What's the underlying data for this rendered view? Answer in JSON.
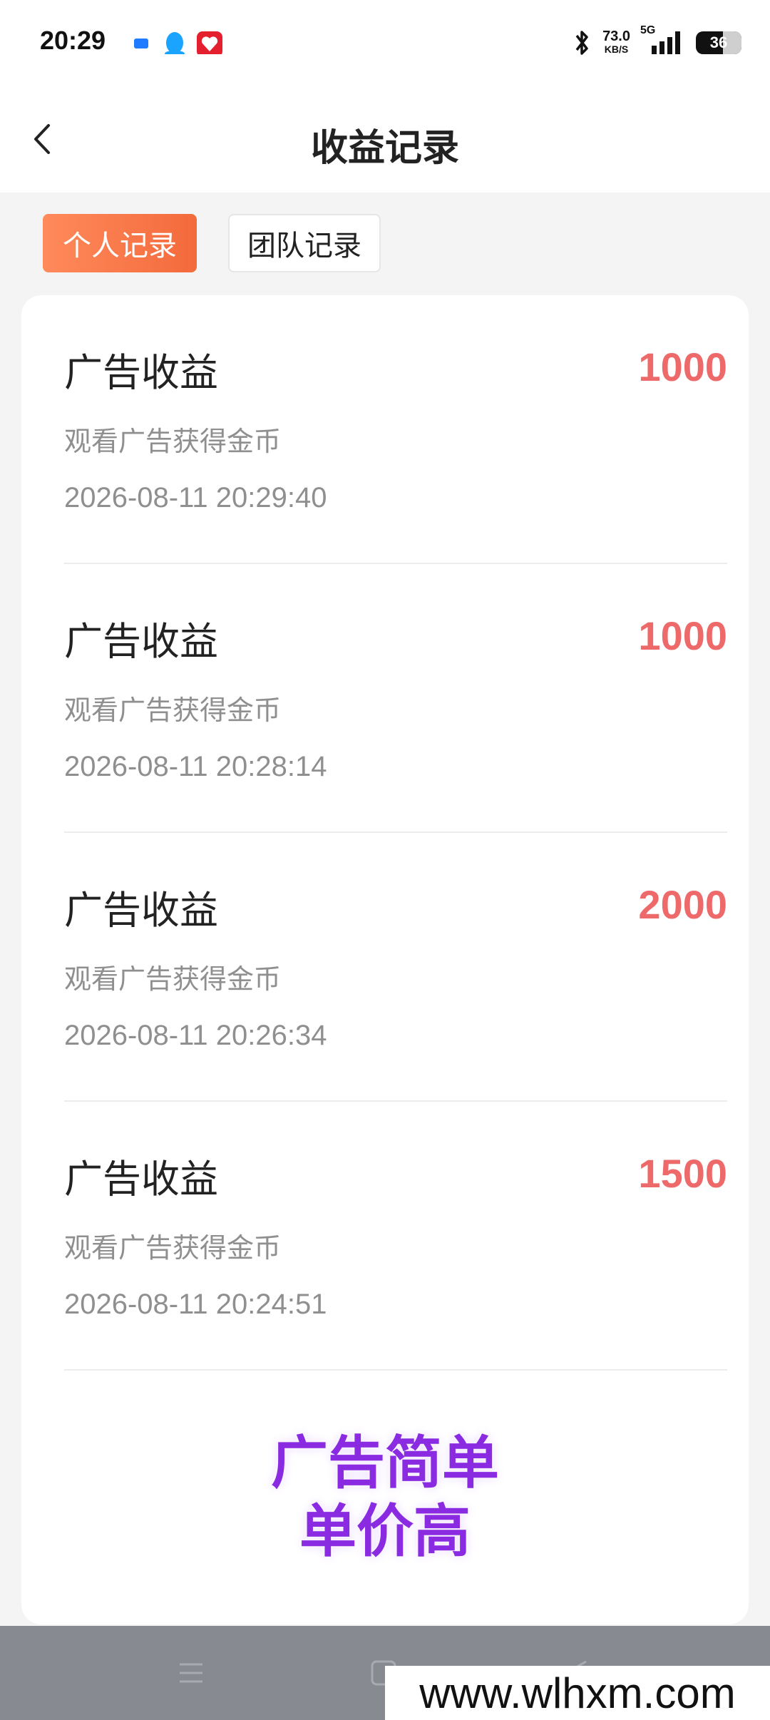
{
  "status_bar": {
    "time": "20:29",
    "icons_left": [
      "message-app-icon",
      "qq-icon",
      "app-red-icon"
    ],
    "net_speed_value": "73.0",
    "net_speed_unit": "KB/S",
    "network": "5G",
    "battery": "36"
  },
  "header": {
    "title": "收益记录"
  },
  "tabs": [
    {
      "label": "个人记录",
      "active": true
    },
    {
      "label": "团队记录",
      "active": false
    }
  ],
  "records": [
    {
      "title": "广告收益",
      "amount": "1000",
      "desc": "观看广告获得金币",
      "time": "2026-08-11 20:29:40"
    },
    {
      "title": "广告收益",
      "amount": "1000",
      "desc": "观看广告获得金币",
      "time": "2026-08-11 20:28:14"
    },
    {
      "title": "广告收益",
      "amount": "2000",
      "desc": "观看广告获得金币",
      "time": "2026-08-11 20:26:34"
    },
    {
      "title": "广告收益",
      "amount": "1500",
      "desc": "观看广告获得金币",
      "time": "2026-08-11 20:24:51"
    }
  ],
  "promo": {
    "line1": "广告简单",
    "line2": "单价高"
  },
  "watermark": "www.wlhxm.com",
  "colors": {
    "accent": "#f36a3c",
    "amount": "#ee6a6a",
    "promo": "#8a2be2"
  }
}
